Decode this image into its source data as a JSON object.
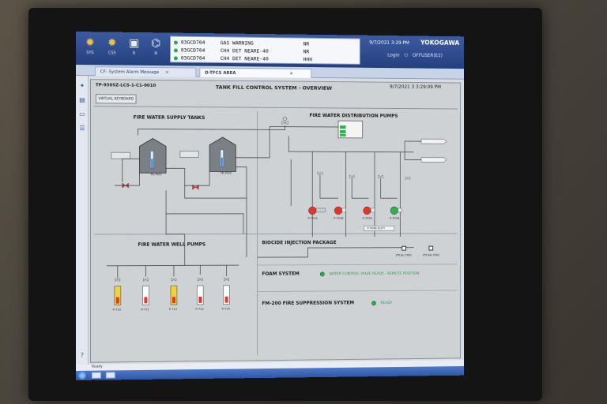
{
  "topbar": {
    "icons": [
      {
        "name": "sun-icon",
        "glyph": "✹",
        "label": "SYS"
      },
      {
        "name": "process-icon",
        "glyph": "✹",
        "label": "CS5"
      },
      {
        "name": "monitor-icon",
        "glyph": "▣",
        "label": "R"
      },
      {
        "name": "network-icon",
        "glyph": "⌬",
        "label": "N"
      }
    ],
    "alarms": [
      {
        "tag": "03GCD704",
        "message": "GAS WARNING",
        "level": "NR"
      },
      {
        "tag": "03GCD704",
        "message": "CH4 DET NEARE-40",
        "level": "NR"
      },
      {
        "tag": "03GCD704",
        "message": "CH4 DET NEARE-40",
        "level": "HHH"
      }
    ],
    "date": "9/7/2021",
    "time": "3:29 PM",
    "brand": "YOKOGAWA",
    "login_label": "Login",
    "user": "OFFUSER(E2)"
  },
  "tabs": [
    {
      "label": "CF- System Alarm Message",
      "close": "×"
    },
    {
      "label": "D-TFCS AREA",
      "close": "×"
    }
  ],
  "graphic": {
    "drawing_id": "TP-9305Z-LCS-1-C1-0010",
    "title": "TANK FILL CONTROL SYSTEM - OVERVIEW",
    "timestamp": "9/7/2021 3   3:29:09 PM",
    "keyboard_button": "VIRTUAL KEYBOARD",
    "sections": {
      "supply_tanks": "FIRE WATER SUPPLY TANKS",
      "distribution_pumps": "FIRE WATER DISTRIBUTION PUMPS",
      "well_pumps": "FIRE WATER WELL PUMPS",
      "biocide": "BIOCIDE INJECTION PACKAGE",
      "foam": "FOAM SYSTEM",
      "fm200": "FM-200 FIRE SUPPRESSION SYSTEM"
    },
    "tanks": [
      {
        "tag": "TK-7001"
      },
      {
        "tag": "TK-7002"
      }
    ],
    "pumps": [
      "P-701A",
      "P-701B",
      "P-702A",
      "P-702B"
    ],
    "duty_label": "P-704B DUTY",
    "well_pump_tags": [
      "P-710",
      "P-711",
      "P-712",
      "P-713",
      "P-714"
    ],
    "biocide_alarms": [
      "ZYLAL-7001",
      "ZYLAH-7001"
    ],
    "foam_status": "WATER CONTROL VALVE READY - REMOTE POSITION",
    "fm200_status": "READY"
  },
  "statusbar": {
    "text": "Ready"
  },
  "colors": {
    "pump_red": "#e8332a",
    "pump_green": "#2fb34a",
    "led_green": "#27b34a",
    "pipe": "#3a3a3a"
  }
}
